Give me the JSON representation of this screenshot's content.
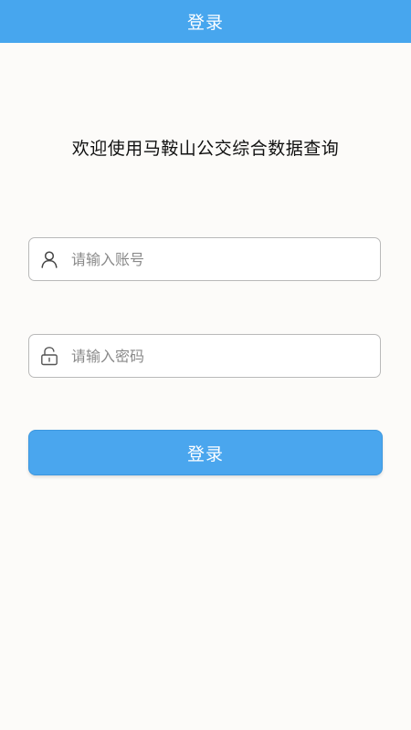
{
  "header": {
    "title": "登录"
  },
  "welcome": {
    "text": "欢迎使用马鞍山公交综合数据查询"
  },
  "form": {
    "account": {
      "icon": "user-icon",
      "placeholder": "请输入账号",
      "value": ""
    },
    "password": {
      "icon": "lock-icon",
      "placeholder": "请输入密码",
      "value": ""
    },
    "submit_label": "登录"
  },
  "colors": {
    "primary": "#47a6ee",
    "background": "#fcfbf9",
    "border": "#b9b9b9"
  }
}
